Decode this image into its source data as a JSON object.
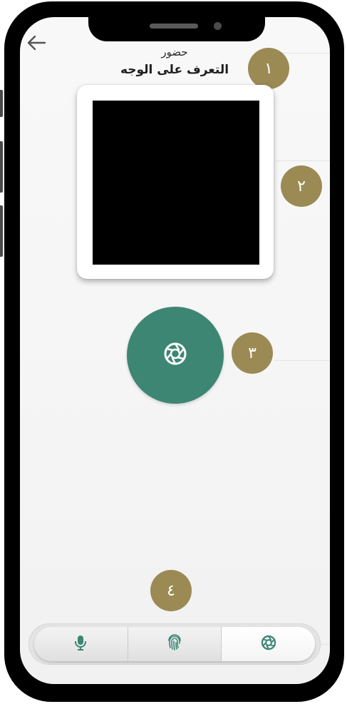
{
  "header": {
    "back_icon": "arrow-left-icon",
    "subtitle": "حضور",
    "title": "التعرف على الوجه"
  },
  "camera": {
    "preview_color": "#000000"
  },
  "capture_button": {
    "icon": "camera-shutter-icon",
    "color": "#3d8673"
  },
  "badges": [
    "١",
    "٢",
    "٣",
    "٤"
  ],
  "badge_color": "#9b8a54",
  "tabbar": {
    "tabs": [
      {
        "icon": "microphone-icon",
        "active": false
      },
      {
        "icon": "fingerprint-icon",
        "active": false
      },
      {
        "icon": "camera-shutter-icon",
        "active": true
      }
    ]
  }
}
